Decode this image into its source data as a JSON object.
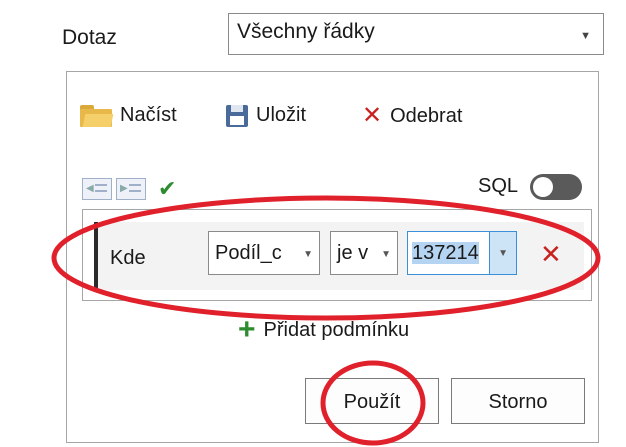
{
  "query": {
    "label": "Dotaz",
    "selected": "Všechny řádky"
  },
  "toolbar": {
    "load_label": "Načíst",
    "save_label": "Uložit",
    "remove_label": "Odebrat"
  },
  "sql": {
    "label": "SQL",
    "enabled": false
  },
  "condition": {
    "where_label": "Kde",
    "field": "Podíl_c",
    "operator": "je v",
    "value": "137214"
  },
  "add_condition_label": "Přidat podmínku",
  "buttons": {
    "apply": "Použít",
    "cancel": "Storno"
  },
  "colors": {
    "highlight": "#e0202a",
    "accent_blue": "#3a8fd6",
    "remove_red": "#c9211e",
    "add_green": "#2e8b2e"
  }
}
